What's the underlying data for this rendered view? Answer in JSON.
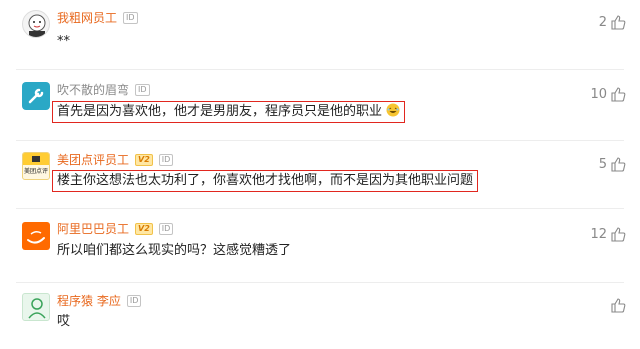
{
  "comments": [
    {
      "username": "我粗网员工",
      "id_label": "ID",
      "text": "**",
      "likes": "2",
      "username_color": "#e8691f",
      "avatar_icon": "cartoon-face-avatar"
    },
    {
      "username": "吹不散的眉弯",
      "id_label": "ID",
      "text": "首先是因为喜欢他，他才是男朋友，程序员只是他的职业",
      "likes": "10",
      "username_color": "#8a8a8a",
      "avatar_icon": "wrench-avatar"
    },
    {
      "username": "美团点评员工",
      "v_label": "V2",
      "id_label": "ID",
      "avatar_text": "美团点评",
      "text": "楼主你这想法也太功利了，你喜欢他才找他啊，而不是因为其他职业问题",
      "likes": "5",
      "username_color": "#e8691f",
      "avatar_icon": "meituan-logo-avatar"
    },
    {
      "username": "阿里巴巴员工",
      "v_label": "V2",
      "id_label": "ID",
      "text": "所以咱们都这么现实的吗？这感觉糟透了",
      "likes": "12",
      "username_color": "#e8691f",
      "avatar_icon": "alibaba-logo-avatar"
    },
    {
      "username": "程序猿 李应",
      "id_label": "ID",
      "text": "哎",
      "likes": "",
      "username_color": "#e8691f",
      "avatar_icon": "user-silhouette-avatar"
    }
  ]
}
